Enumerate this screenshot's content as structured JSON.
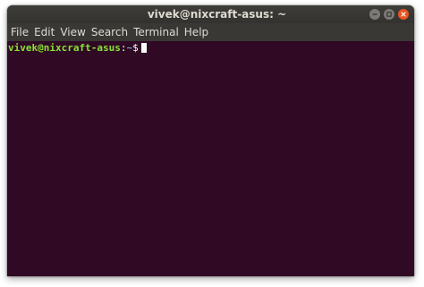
{
  "window": {
    "title": "vivek@nixcraft-asus: ~",
    "controls": [
      {
        "name": "minimize",
        "icon": "minimize-icon"
      },
      {
        "name": "maximize",
        "icon": "maximize-icon"
      },
      {
        "name": "close",
        "icon": "close-icon"
      }
    ]
  },
  "menu": {
    "items": [
      "File",
      "Edit",
      "View",
      "Search",
      "Terminal",
      "Help"
    ]
  },
  "terminal": {
    "prompt": {
      "user_host": "vivek@nixcraft-asus",
      "colon": ":",
      "path": "~",
      "symbol": "$"
    }
  },
  "colors": {
    "terminal_background": "#300a24",
    "titlebar": "#3a3935",
    "prompt_user": "#8ae234",
    "prompt_path": "#729fcf",
    "close_button": "#e95420"
  }
}
